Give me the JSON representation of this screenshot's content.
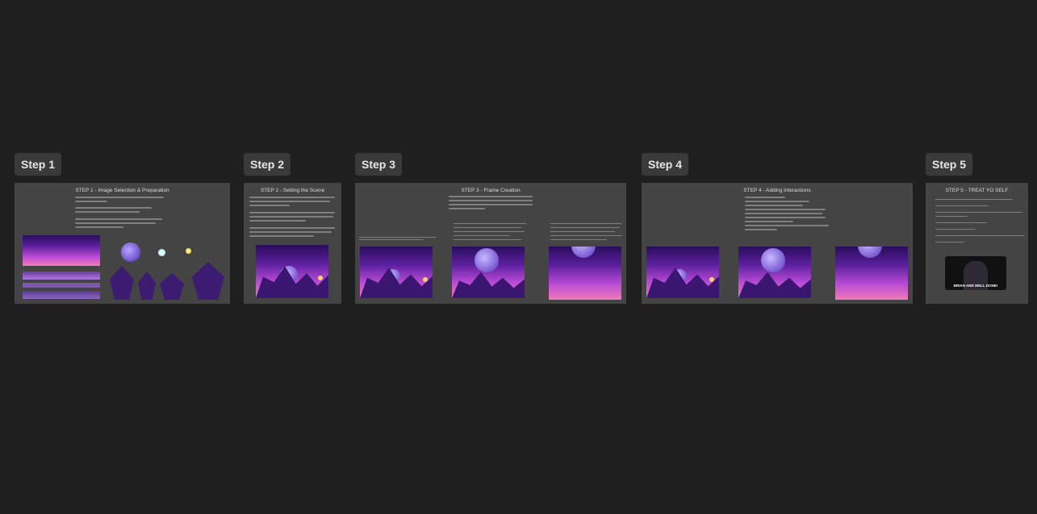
{
  "steps": [
    {
      "label": "Step 1",
      "title": "STEP 1 - Image Selection & Preparation"
    },
    {
      "label": "Step 2",
      "title": "STEP 2 - Setting the Scene"
    },
    {
      "label": "Step 3",
      "title": "STEP 3 - Frame Creation"
    },
    {
      "label": "Step 4",
      "title": "STEP 4 - Adding Interactions"
    },
    {
      "label": "Step 5",
      "title": "STEP 5 - TREAT YO SELF"
    }
  ],
  "video_caption": "BRIAN AND WELL DONE!",
  "colors": {
    "background": "#1f1f1f",
    "frame": "#444444",
    "label_bg": "#3a3a3a"
  }
}
